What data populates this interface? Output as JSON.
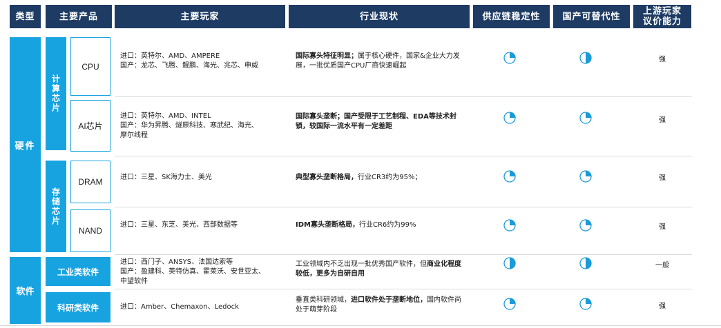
{
  "headers": {
    "type": "类型",
    "product": "主要产品",
    "players": "主要玩家",
    "status": "行业现状",
    "supply": "供应链稳定性",
    "substitution": "国产可替代性",
    "bargaining": "上游玩家\n议价能力"
  },
  "categories": {
    "hardware": "硬件",
    "software": "软件"
  },
  "subcategories": {
    "compute": "计算芯片",
    "storage": "存储芯片"
  },
  "rows": [
    {
      "product": "CPU",
      "players": [
        "进口：英特尔、AMD、AMPERE",
        "国产：龙芯、飞腾、鲲鹏、海光、兆芯、申威"
      ],
      "status_bold": "国际寡头特征明显；",
      "status_rest": "属于核心硬件，国家&企业大力发展，一批优质国产CPU厂商快速崛起",
      "supply_level": 0.25,
      "substitution_level": 0.5,
      "bargaining": "强"
    },
    {
      "product": "AI芯片",
      "players": [
        "进口：英特尔、AMD、INTEL",
        "国产：华为昇腾、燧原科技、寒武纪、海光、",
        "摩尔线程"
      ],
      "status_bold": "国际寡头垄断；国产受限于工艺制程、EDA等技术封锁，较国际一流水平有一定差距",
      "status_rest": "",
      "supply_level": 0.25,
      "substitution_level": 0.25,
      "bargaining": "强"
    },
    {
      "product": "DRAM",
      "players": [
        "进口：三星、SK海力士、美光"
      ],
      "status_bold": "典型寡头垄断格局，",
      "status_rest": "行业CR3约为95%；",
      "supply_level": 0.25,
      "substitution_level": 0.25,
      "bargaining": "强"
    },
    {
      "product": "NAND",
      "players": [
        "进口：三星、东芝、美光、西部数据等"
      ],
      "status_bold": "IDM寡头垄断格局，",
      "status_rest": "行业CR6约为99%",
      "supply_level": 0.25,
      "substitution_level": 0.25,
      "bargaining": "强"
    },
    {
      "product": "工业类软件",
      "players": [
        "进口：西门子、ANSYS、法国达索等",
        "国产：盈建科、英特仿真、霍莱沃、安世亚太、",
        "中望软件"
      ],
      "status_bold": "",
      "status_rest": "工业领域内不乏出现一批优秀国产软件，但",
      "status_bold2": "商业化程度较低，更多为自研自用",
      "supply_level": 0.5,
      "substitution_level": 0.5,
      "bargaining": "一般"
    },
    {
      "product": "科研类软件",
      "players": [
        "进口：Amber、Chemaxon、Ledock"
      ],
      "status_bold": "",
      "status_rest": "垂直类科研领域，",
      "status_bold2": "进口软件处于垄断地位，",
      "status_rest2": "国内软件尚处于萌芽阶段",
      "supply_level": 0.25,
      "substitution_level": 0.25,
      "bargaining": "强"
    }
  ],
  "colors": {
    "header_bg": "#1d3b63",
    "accent": "#17a3e0",
    "pie_fill": "#1a9bd7"
  }
}
